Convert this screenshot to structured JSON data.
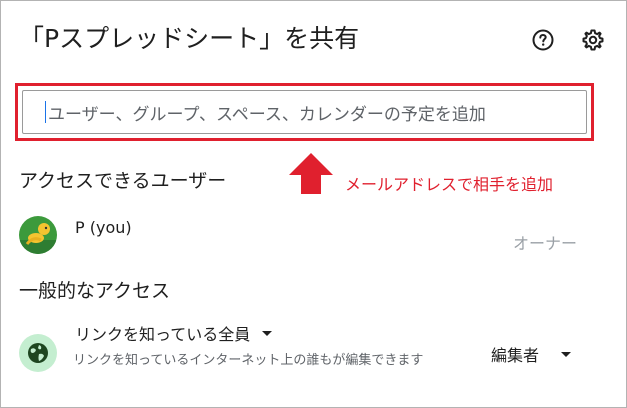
{
  "dialog": {
    "title": "「Pスプレッドシート」を共有",
    "icons": {
      "help": "help-circle-icon",
      "settings": "gear-icon"
    }
  },
  "add_people": {
    "placeholder": "ユーザー、グループ、スペース、カレンダーの予定を追加"
  },
  "annotation": {
    "text": "メールアドレスで相手を追加",
    "color": "#e0202e",
    "icon": "red-up-arrow-icon"
  },
  "access_section": {
    "title": "アクセスできるユーザー",
    "users": [
      {
        "name": "P (you)",
        "role": "オーナー",
        "avatar": "avatar-icon"
      }
    ]
  },
  "general_access": {
    "title": "一般的なアクセス",
    "link_setting": "リンクを知っている全員",
    "description": "リンクを知っているインターネット上の誰もが編集できます",
    "role": "編集者",
    "icon": "globe-icon"
  },
  "colors": {
    "highlight": "#e0202e",
    "globe_bg": "#c4eed0"
  }
}
